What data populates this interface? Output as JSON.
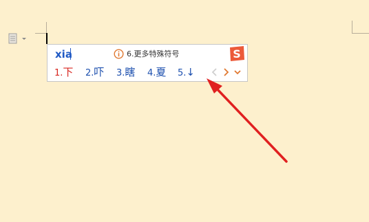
{
  "document": {
    "left_icon": "page-options-icon"
  },
  "ime": {
    "pinyin": "xia",
    "hint_icon": "info-icon",
    "hint_text": "6.更多特殊符号",
    "brand_logo": "sogou-s-logo",
    "candidates": [
      {
        "num": "1.",
        "text": "下"
      },
      {
        "num": "2.",
        "text": "吓"
      },
      {
        "num": "3.",
        "text": "瞎"
      },
      {
        "num": "4.",
        "text": "夏"
      },
      {
        "num": "5.",
        "text": "↓"
      }
    ],
    "nav_icons": [
      "chevron-left-icon",
      "chevron-right-icon",
      "chevron-down-icon"
    ]
  },
  "colors": {
    "page_bg": "#fdf0cd",
    "pinyin": "#1f59c4",
    "candidate_first": "#d8251f",
    "candidate": "#1c4fae",
    "annotation_arrow": "#e02020",
    "logo": "#ec5a3a"
  }
}
